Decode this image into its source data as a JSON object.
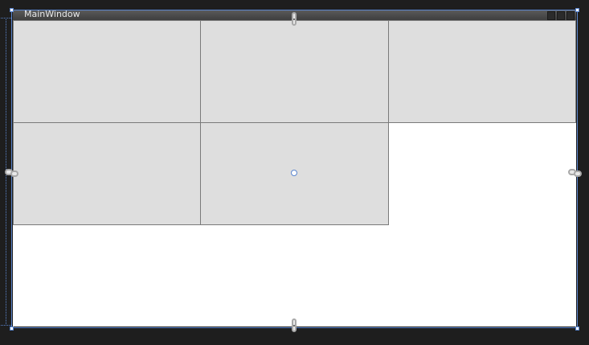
{
  "window": {
    "title": "MainWindow"
  },
  "colors": {
    "background": "#1e1e1e",
    "selection": "#5b86cf",
    "cell_fill": "#dedede",
    "cell_border": "#7a7a7a",
    "client": "#ffffff"
  },
  "icons": {
    "anchor": "chain-link-icon",
    "handle": "resize-handle"
  }
}
